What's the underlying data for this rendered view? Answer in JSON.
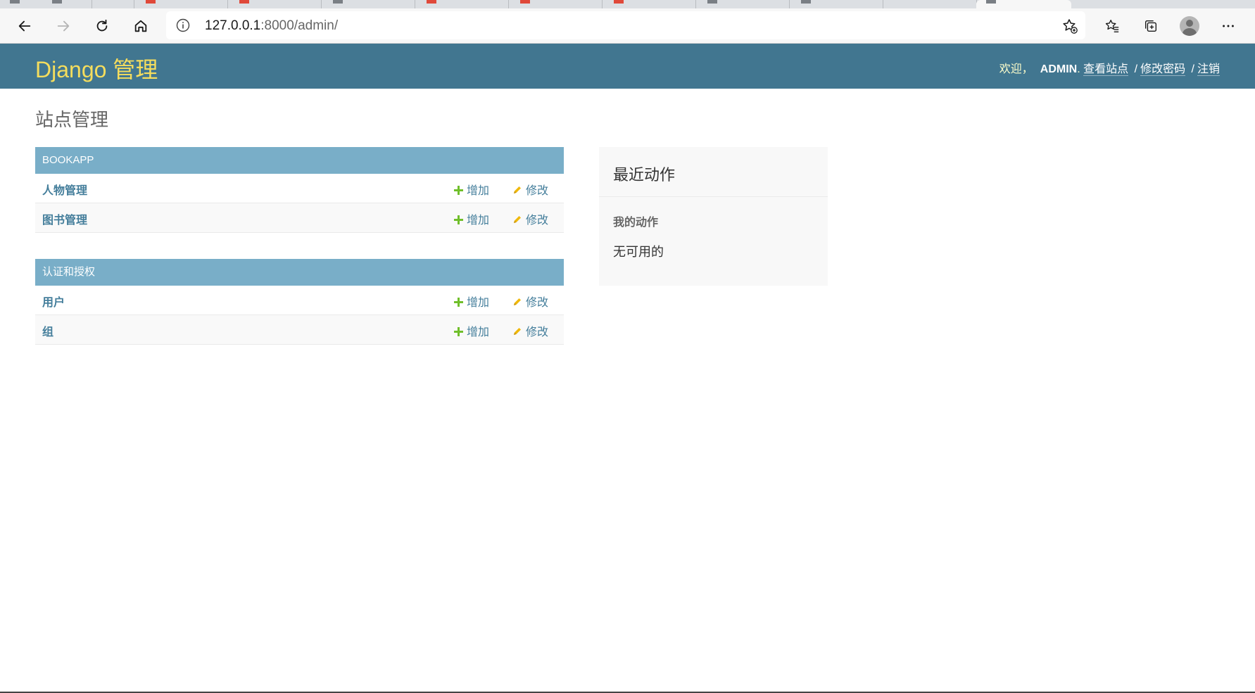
{
  "browser": {
    "url_host": "127.0.0.1",
    "url_rest": ":8000/admin/"
  },
  "header": {
    "branding": "Django 管理",
    "welcome": "欢迎，",
    "username": "ADMIN",
    "dot": ".",
    "view_site": "查看站点",
    "sep": "/",
    "change_password": "修改密码",
    "logout": "注销"
  },
  "page_title": "站点管理",
  "modules": [
    {
      "caption": "BOOKAPP",
      "rows": [
        {
          "model": "人物管理",
          "add": "增加",
          "change": "修改"
        },
        {
          "model": "图书管理",
          "add": "增加",
          "change": "修改"
        }
      ]
    },
    {
      "caption": "认证和授权",
      "rows": [
        {
          "model": "用户",
          "add": "增加",
          "change": "修改"
        },
        {
          "model": "组",
          "add": "增加",
          "change": "修改"
        }
      ]
    }
  ],
  "recent_actions": {
    "title": "最近动作",
    "subtitle": "我的动作",
    "empty": "无可用的"
  },
  "colors": {
    "header_bg": "#417690",
    "branding": "#f5dd5d",
    "caption_bg": "#79aec8",
    "link": "#447e9b",
    "add_icon": "#70bf2b",
    "change_icon": "#efb80b"
  }
}
